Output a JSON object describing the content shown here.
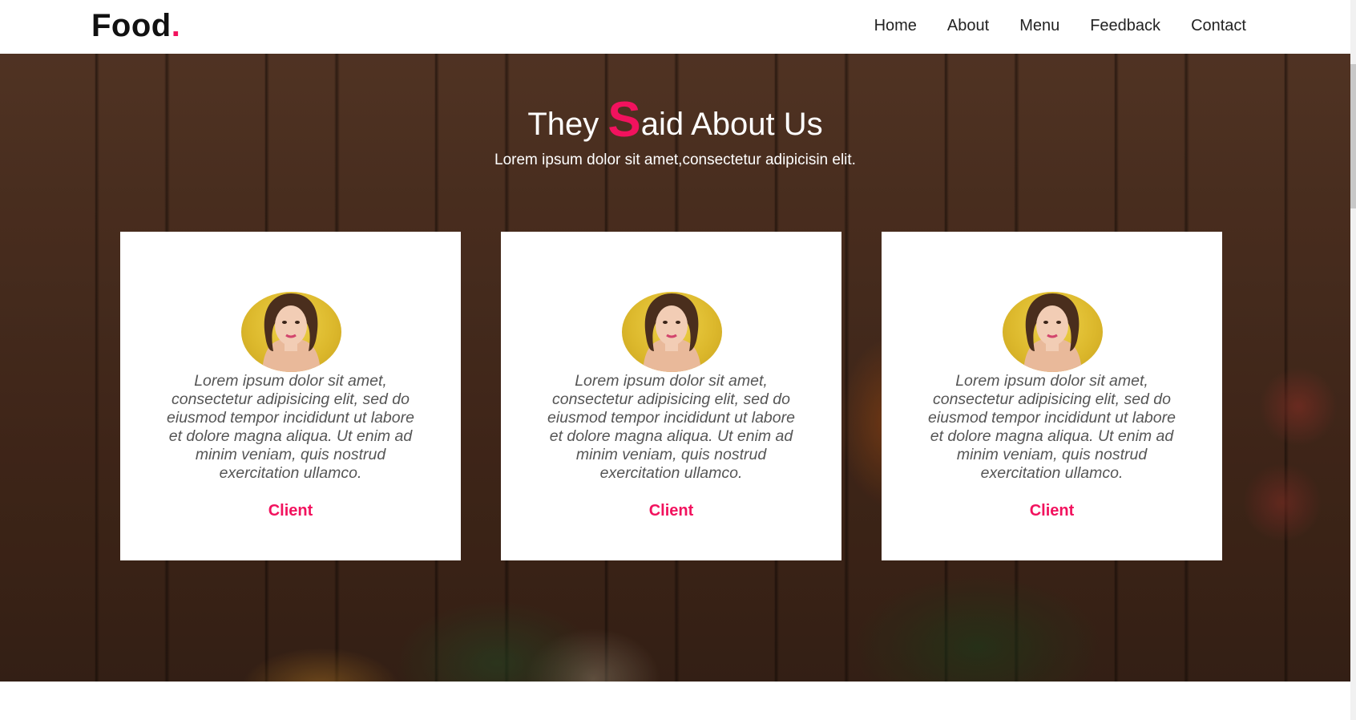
{
  "header": {
    "brand_text": "Food",
    "brand_dot": ".",
    "nav": [
      "Home",
      "About",
      "Menu",
      "Feedback",
      "Contact"
    ]
  },
  "testimonials": {
    "title_before": "They ",
    "title_accent": "S",
    "title_after": "aid About Us",
    "subtitle": "Lorem ipsum dolor sit amet,consectetur adipicisin elit.",
    "cards": [
      {
        "quote": "Lorem ipsum dolor sit amet, consectetur adipisicing elit, sed do eiusmod tempor incididunt ut labore et dolore magna aliqua. Ut enim ad minim veniam, quis nostrud exercitation ullamco.",
        "name": "Client"
      },
      {
        "quote": "Lorem ipsum dolor sit amet, consectetur adipisicing elit, sed do eiusmod tempor incididunt ut labore et dolore magna aliqua. Ut enim ad minim veniam, quis nostrud exercitation ullamco.",
        "name": "Client"
      },
      {
        "quote": "Lorem ipsum dolor sit amet, consectetur adipisicing elit, sed do eiusmod tempor incididunt ut labore et dolore magna aliqua. Ut enim ad minim veniam, quis nostrud exercitation ullamco.",
        "name": "Client"
      }
    ]
  },
  "colors": {
    "accent": "#f2125e",
    "brand_text": "#111111",
    "nav_text": "#222222",
    "card_text": "#555555"
  }
}
